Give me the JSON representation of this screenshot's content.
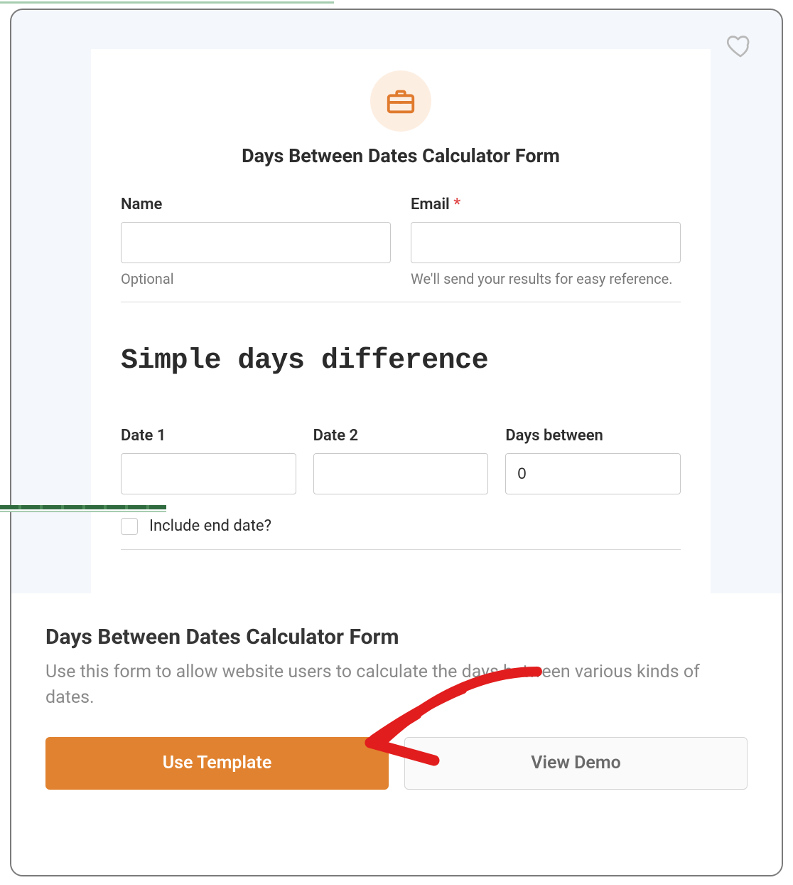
{
  "form": {
    "title": "Days Between Dates Calculator Form",
    "name_label": "Name",
    "name_helper": "Optional",
    "email_label": "Email",
    "email_required_mark": "*",
    "email_helper": "We'll send your results for easy reference.",
    "section1_title": "Simple days difference",
    "date1_label": "Date 1",
    "date2_label": "Date 2",
    "days_between_label": "Days between",
    "days_between_value": "0",
    "include_end_label": "Include end date?"
  },
  "footer": {
    "title": "Days Between Dates Calculator Form",
    "description": "Use this form to allow website users to calculate the days between various kinds of dates.",
    "use_template_label": "Use Template",
    "view_demo_label": "View Demo"
  }
}
